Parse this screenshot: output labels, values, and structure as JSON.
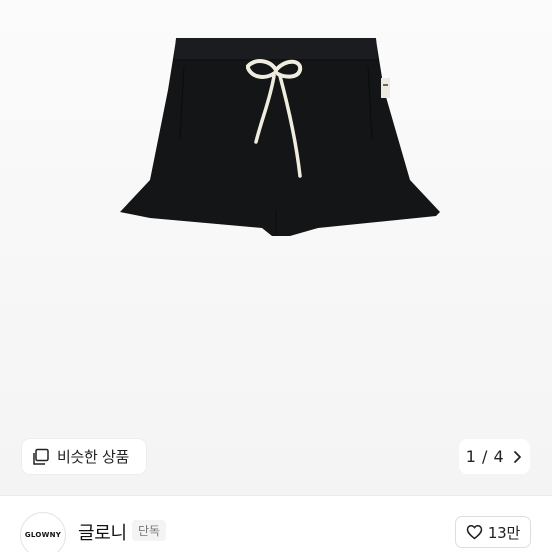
{
  "product": {
    "brand_logo": "GLOWNY",
    "label_tag": "GLOWNY"
  },
  "similar": {
    "icon": "similar-items-icon",
    "label": "비슷한 상품"
  },
  "pager": {
    "text": "1 / 4",
    "icon": "chevron-right-icon"
  },
  "seller": {
    "avatar_text": "GLOWNY",
    "name": "글로니",
    "badge": "단독"
  },
  "like": {
    "icon": "heart-icon",
    "count": "13만"
  }
}
